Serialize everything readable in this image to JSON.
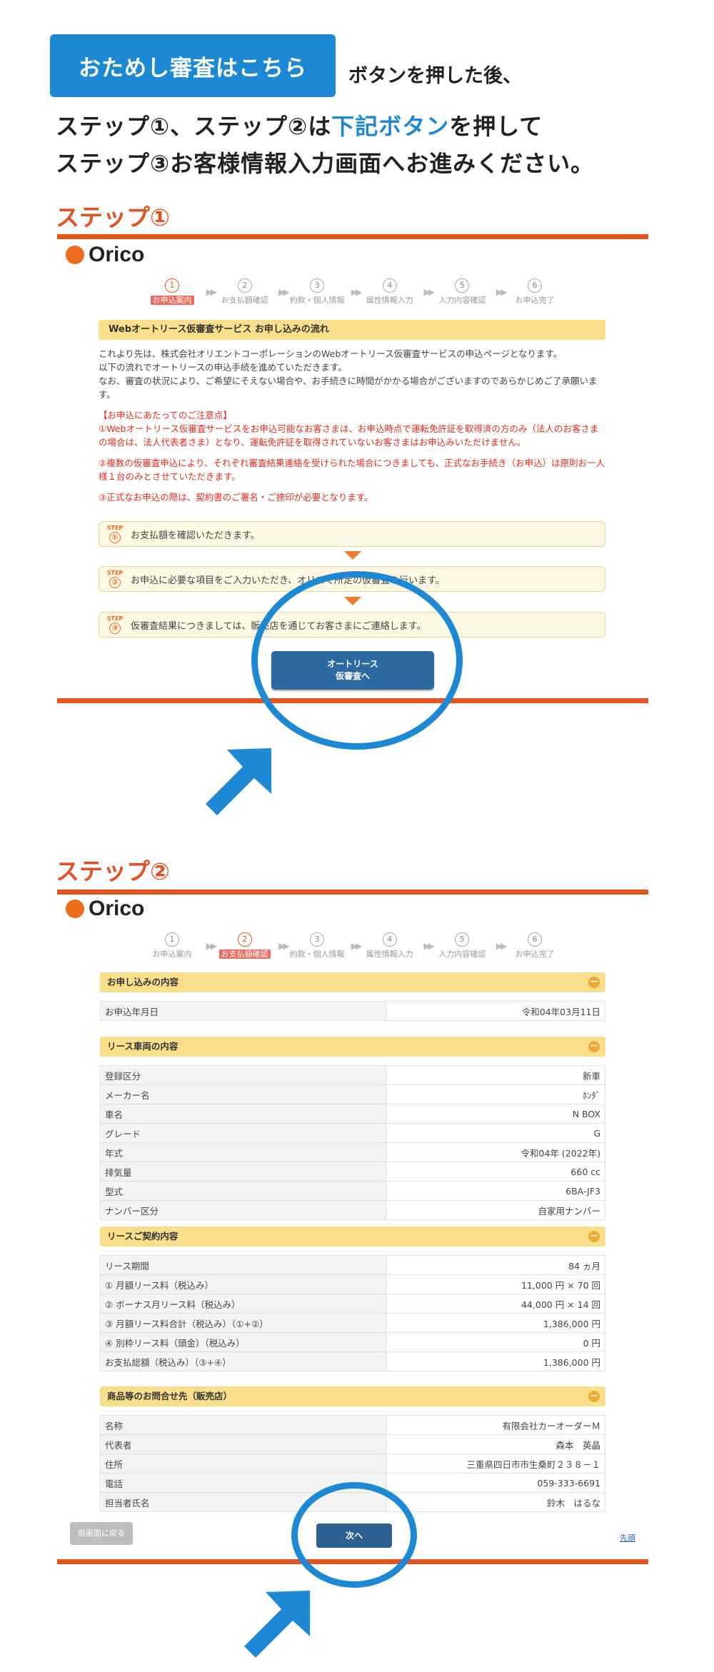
{
  "intro": {
    "trial_button": "おためし審査はこちら",
    "after_text": "ボタンを押した後、",
    "line2_a": "ステップ①、ステップ②は",
    "line2_hl": "下記ボタン",
    "line2_b": "を押して",
    "line3": "ステップ③お客様情報入力画面へお進みください。"
  },
  "colors": {
    "accent_blue": "#1d88d4",
    "accent_orange": "#e5541f",
    "section_yellow": "#f9df8c",
    "button_navy": "#2d6aa1"
  },
  "progress_steps": [
    {
      "num": "1",
      "label": "お申込案内"
    },
    {
      "num": "2",
      "label": "お支払額確認"
    },
    {
      "num": "3",
      "label": "約款・個人情報"
    },
    {
      "num": "4",
      "label": "属性情報入力"
    },
    {
      "num": "5",
      "label": "入力内容確認"
    },
    {
      "num": "6",
      "label": "お申込完了"
    }
  ],
  "step1": {
    "heading": "ステップ①",
    "logo": "Orico",
    "title": "Webオートリース仮審査サービス お申し込みの流れ",
    "body1": "これより先は、株式会社オリエントコーポレーションのWebオートリース仮審査サービスの申込ページとなります。",
    "body2": "以下の流れでオートリースの申込手続を進めていただきます。",
    "body3": "なお、審査の状況により、ご希望にそえない場合や、お手続きに時間がかかる場合がございますのであらかじめご了承願います。",
    "notice_title": "【お申込にあたってのご注意点】",
    "notice1": "①Webオートリース仮審査サービスをお申込可能なお客さまは、お申込時点で運転免許証を取得済の方のみ（法人のお客さまの場合は、法人代表者さま）となり、運転免許証を取得されていないお客さまはお申込みいただけません。",
    "notice2": "②複数の仮審査申込により、それぞれ審査結果連絡を受けられた場合につきましても、正式なお手続き（お申込）は原則お一人様１台のみとさせていただきます。",
    "notice3": "③正式なお申込の際は、契約書のご署名・ご捺印が必要となります。",
    "steps": [
      {
        "icon": "①",
        "text": "お支払額を確認いただきます。"
      },
      {
        "icon": "②",
        "text": "お申込に必要な項目をご入力いただき、オリコで所定の仮審査を行います。"
      },
      {
        "icon": "③",
        "text": "仮審査結果につきましては、販売店を通じてお客さまにご連絡します。"
      }
    ],
    "step_tag": "STEP",
    "button_line1": "オートリース",
    "button_line2": "仮審査へ"
  },
  "step2": {
    "heading": "ステップ②",
    "logo": "Orico",
    "sections": {
      "apply": {
        "title": "お申し込みの内容",
        "rows": [
          {
            "k": "お申込年月日",
            "v": "令和04年03月11日"
          }
        ]
      },
      "vehicle": {
        "title": "リース車両の内容",
        "rows": [
          {
            "k": "登録区分",
            "v": "新車"
          },
          {
            "k": "メーカー名",
            "v": "ﾎﾝﾀﾞ"
          },
          {
            "k": "車名",
            "v": "N BOX"
          },
          {
            "k": "グレード",
            "v": "G"
          },
          {
            "k": "年式",
            "v": "令和04年 (2022年)"
          },
          {
            "k": "排気量",
            "v": "660 cc"
          },
          {
            "k": "型式",
            "v": "6BA-JF3"
          },
          {
            "k": "ナンバー区分",
            "v": "自家用ナンバー"
          }
        ]
      },
      "contract": {
        "title": "リースご契約内容",
        "rows": [
          {
            "k": "リース期間",
            "v": "84 ヵ月"
          },
          {
            "k": "① 月額リース料（税込み）",
            "v": "11,000 円 × 70 回"
          },
          {
            "k": "② ボーナス月リース料（税込み）",
            "v": "44,000 円 × 14 回"
          },
          {
            "k": "③ 月額リース料合計（税込み）（①+②）",
            "v": "1,386,000 円"
          },
          {
            "k": "④ 別枠リース料（頭金）（税込み）",
            "v": "0 円"
          },
          {
            "k": "お支払総額（税込み）（③+④）",
            "v": "1,386,000 円"
          }
        ]
      },
      "dealer": {
        "title": "商品等のお問合せ先（販売店）",
        "rows": [
          {
            "k": "名称",
            "v": "有限会社カーオーダーＭ"
          },
          {
            "k": "代表者",
            "v": "森本　英晶"
          },
          {
            "k": "住所",
            "v": "三重県四日市市生桑町２３８－１"
          },
          {
            "k": "電話",
            "v": "059-333-6691"
          },
          {
            "k": "担当者氏名",
            "v": "鈴木　はるな"
          }
        ]
      }
    },
    "back_button": "前画面に戻る",
    "next_button": "次へ",
    "top_link": "先頭"
  }
}
